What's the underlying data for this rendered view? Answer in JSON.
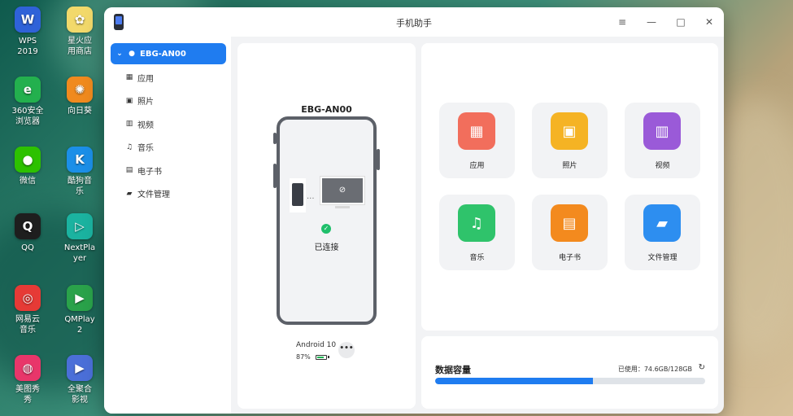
{
  "desktop": {
    "icons": [
      {
        "label": "WPS\n2019",
        "color": "#2f62d8",
        "glyph": "W",
        "icon": "wps-icon"
      },
      {
        "label": "星火应\n用商店",
        "color": "#f2d96b",
        "glyph": "✿",
        "icon": "app-store-icon"
      },
      {
        "label": "360安全\n浏览器",
        "color": "#23b04e",
        "glyph": "e",
        "icon": "browser-icon"
      },
      {
        "label": "向日葵",
        "color": "#f08a1e",
        "glyph": "✺",
        "icon": "sunflower-icon"
      },
      {
        "label": "微信",
        "color": "#2dc100",
        "glyph": "●",
        "icon": "wechat-icon"
      },
      {
        "label": "酷狗音\n乐",
        "color": "#1b8fe8",
        "glyph": "K",
        "icon": "kugou-icon"
      },
      {
        "label": "QQ",
        "color": "#1e1e1e",
        "glyph": "Q",
        "icon": "qq-icon"
      },
      {
        "label": "NextPla\nyer",
        "color": "#1bb3a0",
        "glyph": "▷",
        "icon": "nextplayer-icon"
      },
      {
        "label": "网易云\n音乐",
        "color": "#e63a36",
        "glyph": "◎",
        "icon": "netease-music-icon"
      },
      {
        "label": "QMPlay\n2",
        "color": "#2aa24a",
        "glyph": "▶",
        "icon": "qmplay-icon"
      },
      {
        "label": "美图秀\n秀",
        "color": "#e8366a",
        "glyph": "◍",
        "icon": "meitu-icon"
      },
      {
        "label": "全聚合\n影视",
        "color": "#4b6fd8",
        "glyph": "▶",
        "icon": "video-app-icon"
      }
    ]
  },
  "window": {
    "title": "手机助手",
    "controls": {
      "menu": "≡",
      "minimize": "—",
      "maximize": "□",
      "close": "✕"
    }
  },
  "sidebar": {
    "device": "EBG-AN00",
    "items": [
      {
        "label": "应用",
        "glyph": "▦"
      },
      {
        "label": "照片",
        "glyph": "▣"
      },
      {
        "label": "视频",
        "glyph": "▥"
      },
      {
        "label": "音乐",
        "glyph": "♫"
      },
      {
        "label": "电子书",
        "glyph": "▤"
      },
      {
        "label": "文件管理",
        "glyph": "▰"
      }
    ]
  },
  "device": {
    "name": "EBG-AN00",
    "status": "已连接",
    "android": "Android 10",
    "battery_text": "87%",
    "battery_level": 0.87,
    "more": "•••"
  },
  "categories": [
    {
      "label": "应用",
      "glyph": "▦",
      "color": "#f26e5c",
      "icon": "apps-icon"
    },
    {
      "label": "照片",
      "glyph": "▣",
      "color": "#f5b324",
      "icon": "photos-icon"
    },
    {
      "label": "视频",
      "glyph": "▥",
      "color": "#9a5ad8",
      "icon": "video-icon"
    },
    {
      "label": "音乐",
      "glyph": "♫",
      "color": "#2fc36b",
      "icon": "music-icon"
    },
    {
      "label": "电子书",
      "glyph": "▤",
      "color": "#f38a1e",
      "icon": "ebook-icon"
    },
    {
      "label": "文件管理",
      "glyph": "▰",
      "color": "#2d8ef0",
      "icon": "file-manager-icon"
    }
  ],
  "storage": {
    "title": "数据容量",
    "used_text": "已使用：74.6GB/128GB",
    "used_fraction": 0.583,
    "refresh": "↻"
  },
  "chart_data": {
    "type": "bar",
    "categories": [
      "已使用"
    ],
    "values": [
      74.6
    ],
    "ylim": [
      0,
      128
    ],
    "title": "数据容量",
    "xlabel": "",
    "ylabel": ""
  }
}
